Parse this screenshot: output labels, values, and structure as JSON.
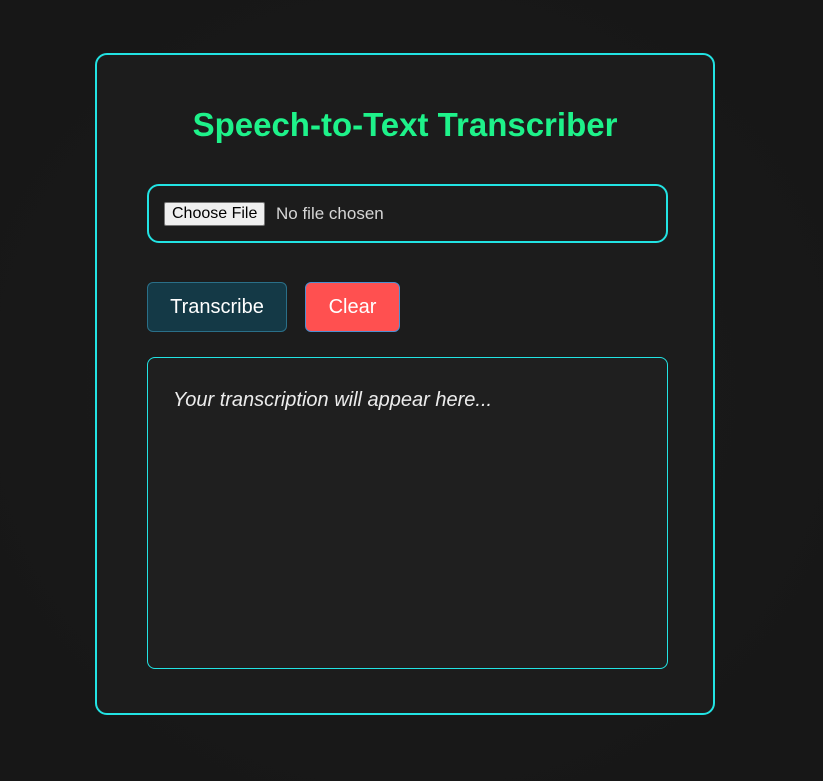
{
  "app": {
    "title": "Speech-to-Text Transcriber"
  },
  "file_input": {
    "button_label": "Choose File",
    "status": "No file chosen"
  },
  "actions": {
    "transcribe_label": "Transcribe",
    "clear_label": "Clear"
  },
  "output": {
    "placeholder": "Your transcription will appear here..."
  },
  "colors": {
    "accent_border": "#22e3e3",
    "title": "#1ef28a",
    "transcribe_bg": "#143946",
    "clear_bg": "#ff5050",
    "background": "#181818"
  }
}
